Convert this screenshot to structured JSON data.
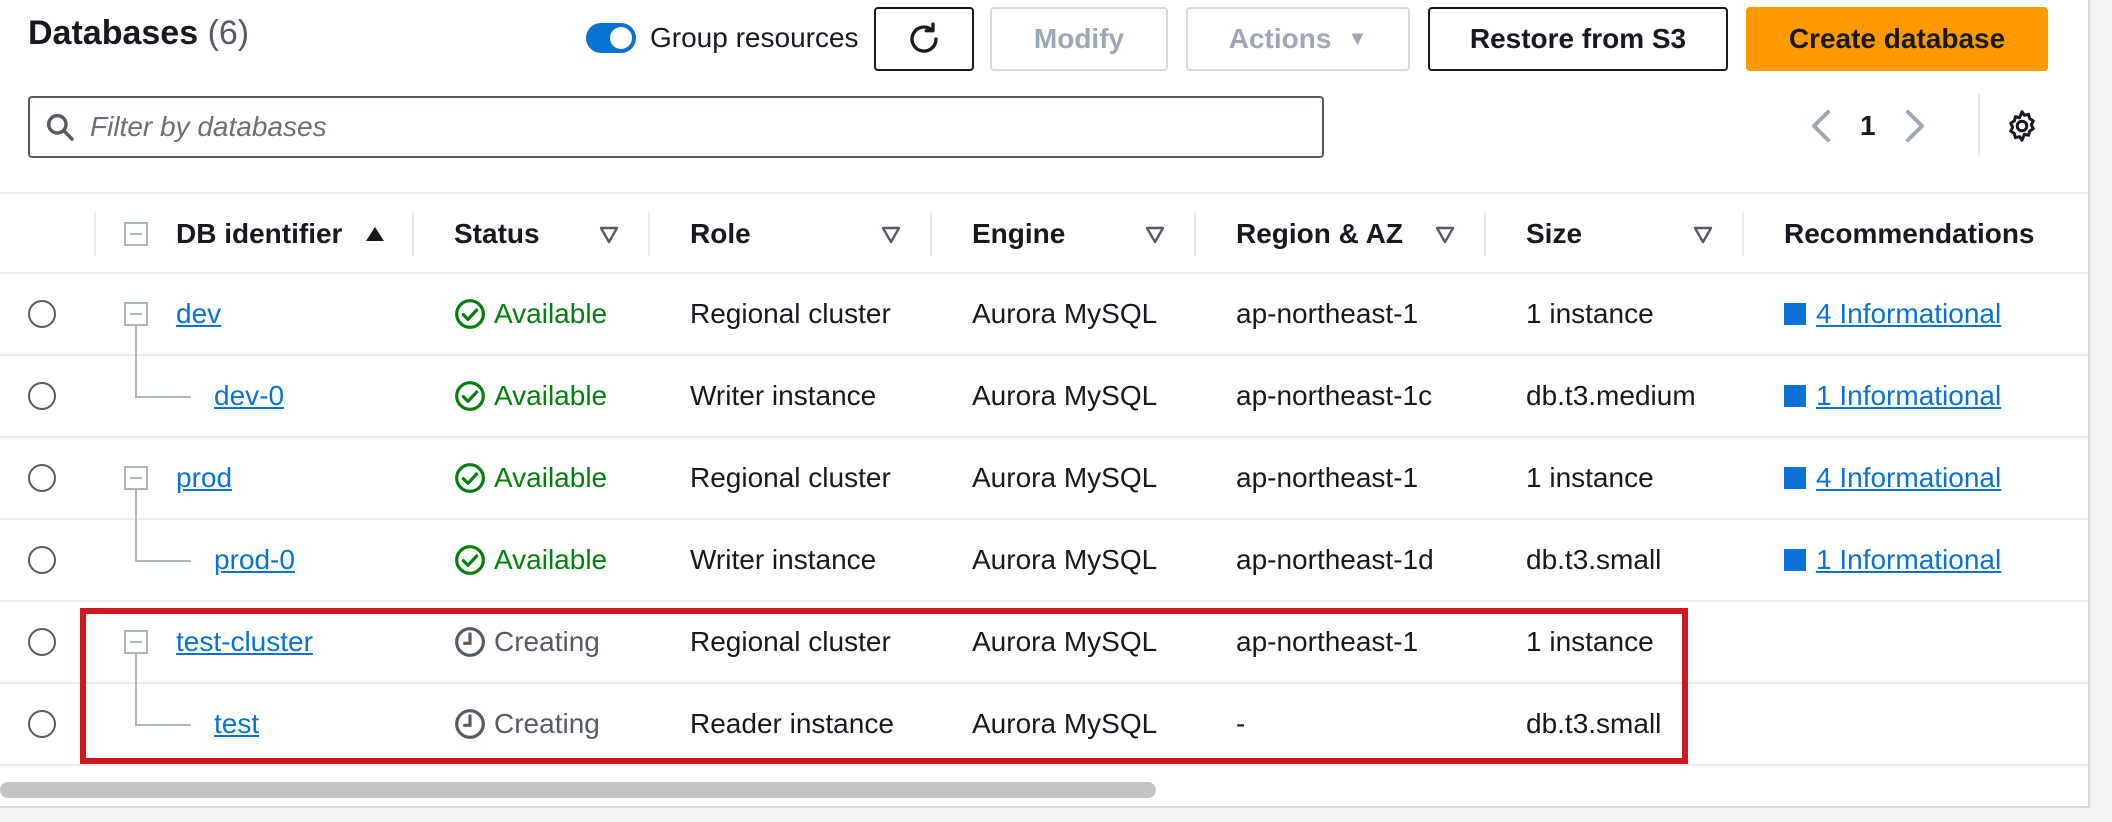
{
  "header": {
    "title": "Databases",
    "count": "(6)",
    "group_toggle_label": "Group resources",
    "group_toggle_on": true,
    "refresh_icon": "refresh-icon",
    "modify_label": "Modify",
    "actions_label": "Actions",
    "restore_label": "Restore from S3",
    "create_label": "Create database"
  },
  "search": {
    "placeholder": "Filter by databases",
    "value": ""
  },
  "pagination": {
    "current_page": "1"
  },
  "table": {
    "columns": [
      "DB identifier",
      "Status",
      "Role",
      "Engine",
      "Region & AZ",
      "Size",
      "Recommendations"
    ],
    "rows": [
      {
        "id": "dev",
        "status": "Available",
        "role": "Regional cluster",
        "engine": "Aurora MySQL",
        "region": "ap-northeast-1",
        "size": "1 instance",
        "recommendation": "4 Informational"
      },
      {
        "id": "dev-0",
        "status": "Available",
        "role": "Writer instance",
        "engine": "Aurora MySQL",
        "region": "ap-northeast-1c",
        "size": "db.t3.medium",
        "recommendation": "1 Informational"
      },
      {
        "id": "prod",
        "status": "Available",
        "role": "Regional cluster",
        "engine": "Aurora MySQL",
        "region": "ap-northeast-1",
        "size": "1 instance",
        "recommendation": "4 Informational"
      },
      {
        "id": "prod-0",
        "status": "Available",
        "role": "Writer instance",
        "engine": "Aurora MySQL",
        "region": "ap-northeast-1d",
        "size": "db.t3.small",
        "recommendation": "1 Informational"
      },
      {
        "id": "test-cluster",
        "status": "Creating",
        "role": "Regional cluster",
        "engine": "Aurora MySQL",
        "region": "ap-northeast-1",
        "size": "1 instance",
        "recommendation": ""
      },
      {
        "id": "test",
        "status": "Creating",
        "role": "Reader instance",
        "engine": "Aurora MySQL",
        "region": "-",
        "size": "db.t3.small",
        "recommendation": ""
      }
    ]
  },
  "colors": {
    "primary_button": "#ff9900",
    "link": "#0972d3",
    "status_available": "#037f0c",
    "status_creating": "#545b64",
    "highlight_box": "#d0191e"
  }
}
